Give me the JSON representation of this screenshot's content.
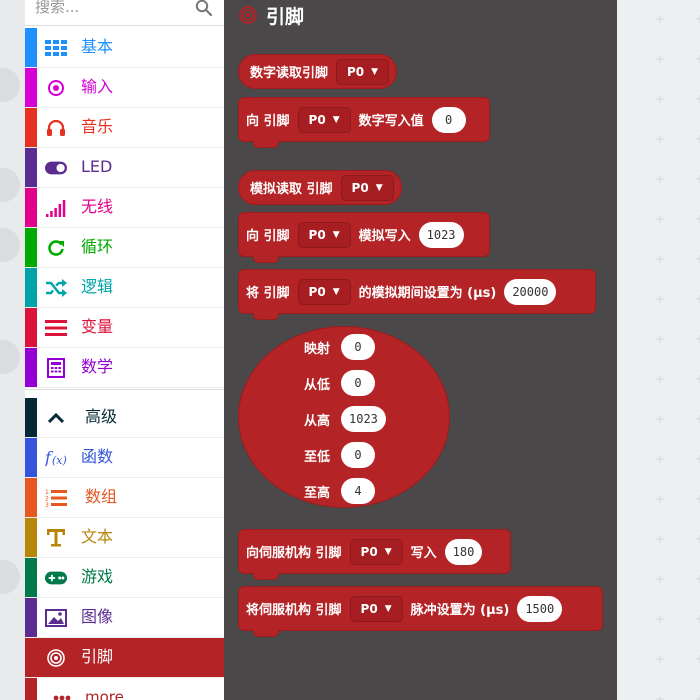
{
  "search": {
    "placeholder": "搜索..."
  },
  "toolbox": {
    "categories": [
      {
        "label": "基本",
        "color": "#1e90ff",
        "icon": "grid-icon"
      },
      {
        "label": "输入",
        "color": "#d400d4",
        "icon": "target-icon"
      },
      {
        "label": "音乐",
        "color": "#e63022",
        "icon": "headphones-icon"
      },
      {
        "label": "LED",
        "color": "#5c2d91",
        "icon": "toggle-icon"
      },
      {
        "label": "无线",
        "color": "#e3008c",
        "icon": "signal-icon"
      },
      {
        "label": "循环",
        "color": "#00aa00",
        "icon": "refresh-icon"
      },
      {
        "label": "逻辑",
        "color": "#00a4a6",
        "icon": "shuffle-icon"
      },
      {
        "label": "变量",
        "color": "#dc143c",
        "icon": "list-icon"
      },
      {
        "label": "数学",
        "color": "#9400d3",
        "icon": "calculator-icon"
      }
    ],
    "advanced": {
      "label": "高级",
      "color": "#062a35",
      "icon": "chevron-up-icon"
    },
    "advanced_categories": [
      {
        "label": "函数",
        "color": "#3455db",
        "icon": "function-icon"
      },
      {
        "label": "数组",
        "color": "#e65722",
        "icon": "ordered-list-icon"
      },
      {
        "label": "文本",
        "color": "#b8860b",
        "icon": "text-icon"
      },
      {
        "label": "游戏",
        "color": "#007a4b",
        "icon": "gamepad-icon"
      },
      {
        "label": "图像",
        "color": "#5c2d91",
        "icon": "image-icon"
      },
      {
        "label": "引脚",
        "color": "#b42326",
        "icon": "pin-icon",
        "selected": true
      },
      {
        "label": "more",
        "color": "#b42326",
        "icon": "dots-icon"
      }
    ]
  },
  "flyout": {
    "title": "引脚",
    "color": "#b42326",
    "blocks": {
      "digital_read": {
        "label": "数字读取引脚",
        "pin": "P0"
      },
      "digital_write": {
        "label_a": "向 引脚",
        "pin": "P0",
        "label_b": "数字写入值",
        "value": "0"
      },
      "analog_read": {
        "label": "模拟读取 引脚",
        "pin": "P0"
      },
      "analog_write": {
        "label_a": "向 引脚",
        "pin": "P0",
        "label_b": "模拟写入",
        "value": "1023"
      },
      "analog_period": {
        "label_a": "将 引脚",
        "pin": "P0",
        "label_b": "的模拟期间设置为 (μs)",
        "value": "20000"
      },
      "map": {
        "value_label": "映射",
        "value": "0",
        "from_low_label": "从低",
        "from_low": "0",
        "from_high_label": "从高",
        "from_high": "1023",
        "to_low_label": "至低",
        "to_low": "0",
        "to_high_label": "至高",
        "to_high": "4"
      },
      "servo_write": {
        "label_a": "向伺服机构 引脚",
        "pin": "P0",
        "label_b": "写入",
        "value": "180"
      },
      "servo_pulse": {
        "label_a": "将伺服机构 引脚",
        "pin": "P0",
        "label_b": "脉冲设置为 (μs)",
        "value": "1500"
      }
    }
  }
}
